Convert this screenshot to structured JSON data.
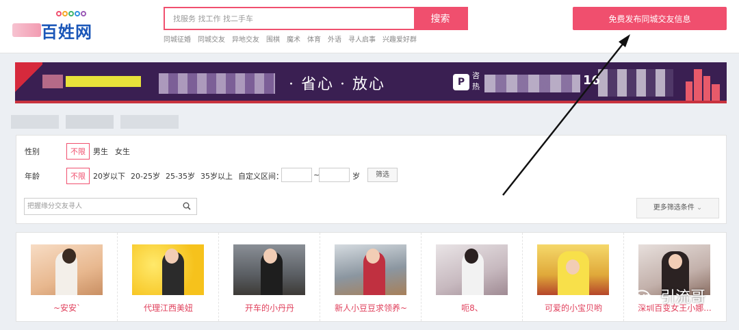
{
  "header": {
    "logo_text": "百姓网",
    "search_placeholder": "找服务 找工作 找二手车",
    "search_button": "搜索",
    "hot_links": [
      "同城征婚",
      "同城交友",
      "异地交友",
      "围棋",
      "魔术",
      "体育",
      "外语",
      "寻人启事",
      "兴趣爱好群"
    ],
    "publish_button": "免费发布同城交友信息"
  },
  "banner": {
    "slogan": "· 省心 · 放心",
    "phone_label": "咨热",
    "number_fragment": "16"
  },
  "filter": {
    "gender_label": "性别",
    "gender_options": [
      "不限",
      "男生",
      "女生"
    ],
    "age_label": "年龄",
    "age_options": [
      "不限",
      "20岁以下",
      "20-25岁",
      "25-35岁",
      "35岁以上"
    ],
    "custom_range_label": "自定义区间：",
    "range_sep": "~",
    "range_unit": "岁",
    "apply_button": "筛选",
    "keyword_placeholder": "把握缘分交友寻人",
    "more_button": "更多筛选条件"
  },
  "results": [
    {
      "name": "~安安`"
    },
    {
      "name": "代理江西美妞"
    },
    {
      "name": "开车的小丹丹"
    },
    {
      "name": "新人小豆豆求领养~"
    },
    {
      "name": "呃8、"
    },
    {
      "name": "可爱的小宝贝哟"
    },
    {
      "name": "深圳百变女王小娜..."
    }
  ],
  "watermark": "引流哥",
  "colors": {
    "accent": "#f04f6e",
    "logo_blue": "#1a56b8",
    "banner_bg": "#3a1f52"
  }
}
